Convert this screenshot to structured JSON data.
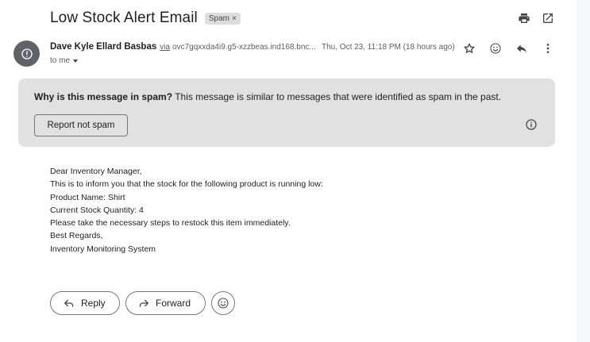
{
  "email": {
    "subject": "Low Stock Alert Email",
    "label": "Spam",
    "label_remove": "×",
    "sender_name": "Dave Kyle Ellard Basbas",
    "via_label": "via",
    "via_address": "ovc7gqxxda4i9.g5-xzzbeas.ind168.bnc...",
    "date": "Thu, Oct 23, 11:18 PM (18 hours ago)",
    "recipient": "to me"
  },
  "spam_notice": {
    "question": "Why is this message in spam?",
    "explanation": "This message is similar to messages that were identified as spam in the past.",
    "report_button": "Report not spam"
  },
  "body_lines": [
    "Dear Inventory Manager,",
    "This is to inform you that the stock for the following product is running low:",
    "Product Name: Shirt",
    "Current Stock Quantity: 4",
    "Please take the necessary steps to restock this item immediately.",
    "Best Regards,",
    "Inventory Monitoring System"
  ],
  "actions": {
    "reply": "Reply",
    "forward": "Forward"
  },
  "icons": {
    "print": "print-icon",
    "open_new_window": "open-in-new-icon",
    "star": "star-icon",
    "emoji": "emoji-icon",
    "reply": "reply-icon",
    "more": "more-vert-icon",
    "info": "info-icon",
    "avatar_warning": "warning-icon"
  }
}
